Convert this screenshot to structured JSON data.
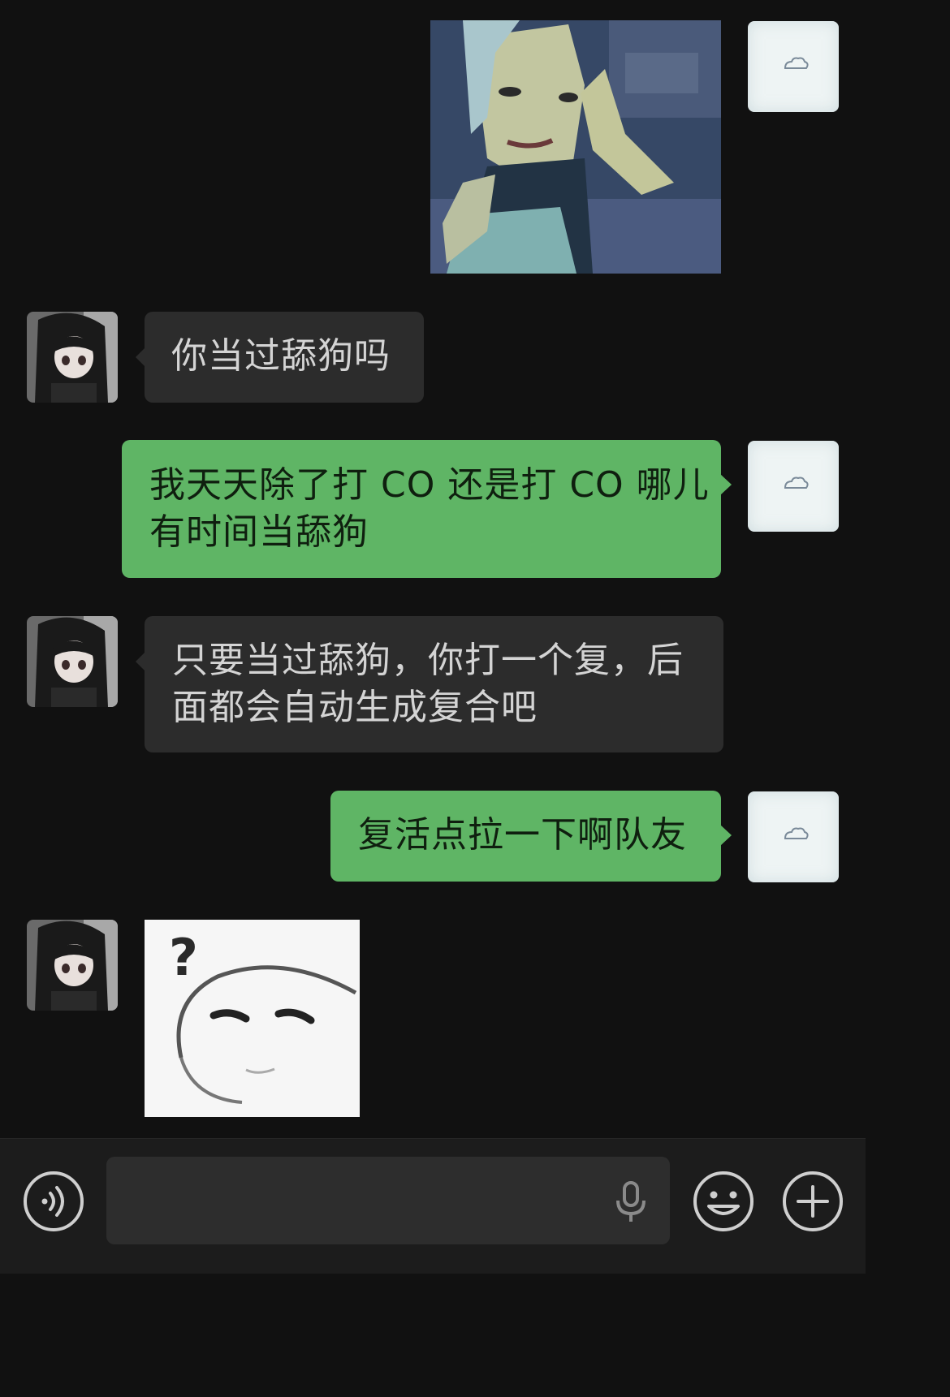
{
  "messages": [
    {
      "sender": "me",
      "type": "image",
      "description": "sticker"
    },
    {
      "sender": "other",
      "type": "text",
      "text": "你当过舔狗吗"
    },
    {
      "sender": "me",
      "type": "text",
      "lines": [
        "我天天除了打 CO 还是打 CO 哪儿",
        "有时间当舔狗"
      ]
    },
    {
      "sender": "other",
      "type": "text",
      "lines": [
        "只要当过舔狗，你打一个复，后",
        "面都会自动生成复合吧"
      ]
    },
    {
      "sender": "me",
      "type": "text",
      "text": "复活点拉一下啊队友"
    },
    {
      "sender": "other",
      "type": "image",
      "sticker_text": "?"
    }
  ],
  "toolbar": {
    "voice_icon": "voice-wave-icon",
    "input_value": "",
    "mic_icon": "microphone-icon",
    "emoji_icon": "smiley-icon",
    "more_icon": "plus-circle-icon"
  },
  "colors": {
    "background": "#111111",
    "incoming_bubble": "#2c2c2c",
    "outgoing_bubble": "#5fb565",
    "toolbar": "#1c1c1c"
  }
}
